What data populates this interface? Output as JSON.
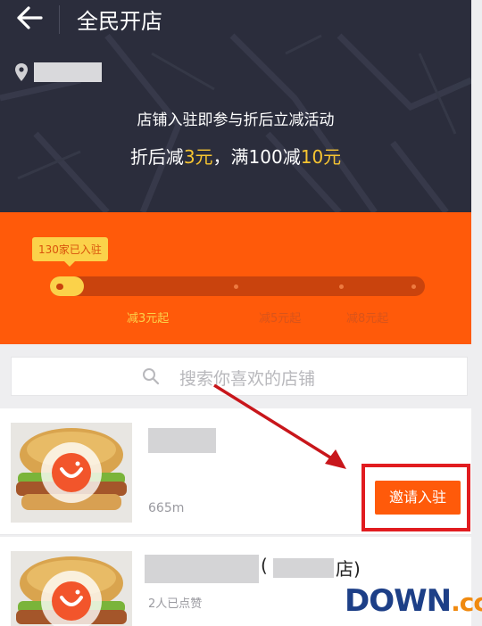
{
  "header": {
    "title": "全民开店",
    "promo_line_1": "店铺入驻即参与折后立减活动",
    "promo_line_2": {
      "part1": "折后减",
      "amount1": "3元",
      "part2": "，满100减",
      "amount2": "10元"
    }
  },
  "progress": {
    "joined_badge": "130家已入驻",
    "fill_fraction": 0.09,
    "tiers": [
      "减3元起",
      "减5元起",
      "减8元起"
    ]
  },
  "search": {
    "placeholder": "搜索你喜欢的店铺"
  },
  "stores": [
    {
      "distance": "665m",
      "invite_label": "邀请入驻"
    },
    {
      "branch_open": "(",
      "branch_close": "店)",
      "likes": "2人已点赞"
    }
  ],
  "watermark": {
    "main": "DOWN",
    "suffix": ".cc"
  },
  "colors": {
    "header_bg": "#2b2d3c",
    "accent_orange": "#ff5a0a",
    "highlight_yellow": "#fbd24a",
    "annotation_red": "#e11c20"
  },
  "icons": [
    "back-arrow-icon",
    "location-pin-icon",
    "search-icon",
    "store-logo-icon"
  ]
}
